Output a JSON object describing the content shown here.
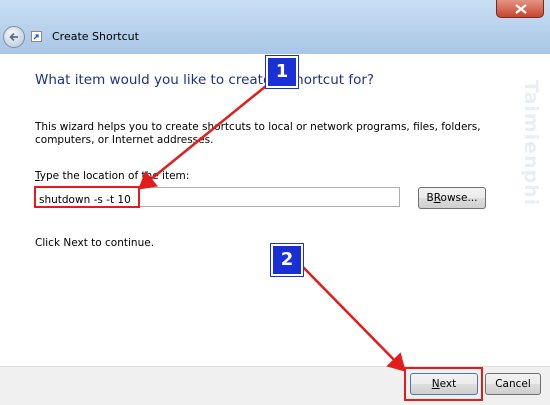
{
  "window": {
    "title": "Create Shortcut"
  },
  "wizard": {
    "heading": "What item would you like to create a shortcut for?",
    "description": "This wizard helps you to create shortcuts to local or network programs, files, folders, computers, or Internet addresses.",
    "location_label_key": "T",
    "location_label_rest": "ype the location of the item:",
    "location_value": "shutdown -s -t 10",
    "browse_key": "R",
    "browse_pre": "B",
    "browse_post": "owse...",
    "continue_text": "Click Next to continue."
  },
  "footer": {
    "next_key": "N",
    "next_rest": "ext",
    "cancel_label": "Cancel"
  },
  "annotations": {
    "step1": "1",
    "step2": "2"
  },
  "watermark": {
    "text": "Taimienphi"
  },
  "colors": {
    "heading": "#1e3287",
    "highlight": "#e31c1c",
    "badge": "#1a2fd6"
  }
}
